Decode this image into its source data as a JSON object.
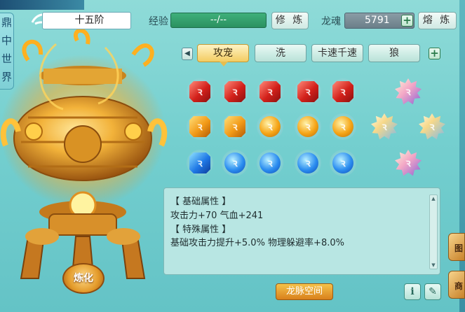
{
  "sidebar": {
    "tab_chars": [
      "鼎",
      "中",
      "世",
      "界"
    ]
  },
  "header": {
    "rank_value": "十五阶",
    "exp_label": "经验",
    "exp_value": "--/--",
    "xiulian_label": "修 炼",
    "soul_label": "龙魂",
    "soul_value": "5791",
    "soul_add_label": "+",
    "ronglian_label": "熔 炼"
  },
  "tabs": {
    "items": [
      {
        "label": "攻宠",
        "active": true
      },
      {
        "label": "洗",
        "active": false
      },
      {
        "label": "卡速千速",
        "active": false
      },
      {
        "label": "狼",
        "active": false
      }
    ],
    "prev_arrow": "◀",
    "add_label": "+"
  },
  "gems": {
    "row1_color": "red",
    "row2_color": "orange",
    "row3_color": "blue",
    "glyph": "ꝛ",
    "side_gems": [
      "star-top",
      "star-left",
      "star-right",
      "star-bottom"
    ]
  },
  "attributes": {
    "lines": [
      "【 基础属性 】",
      "攻击力+70  气血+241",
      "【 特殊属性 】",
      "基础攻击力提升+5.0%  物理躲避率+8.0%"
    ]
  },
  "footer": {
    "longmai_label": "龙脉空间",
    "info_label": "i",
    "edit_label": "✎",
    "lianhua_label": "炼化"
  },
  "right_edge": {
    "tab1": "图",
    "tab2": "商"
  },
  "colors": {
    "bg": "#74cfcf",
    "accent_gold": "#f3cc62",
    "exp_green": "#2a9160",
    "soul_grey": "#6b7f89"
  }
}
